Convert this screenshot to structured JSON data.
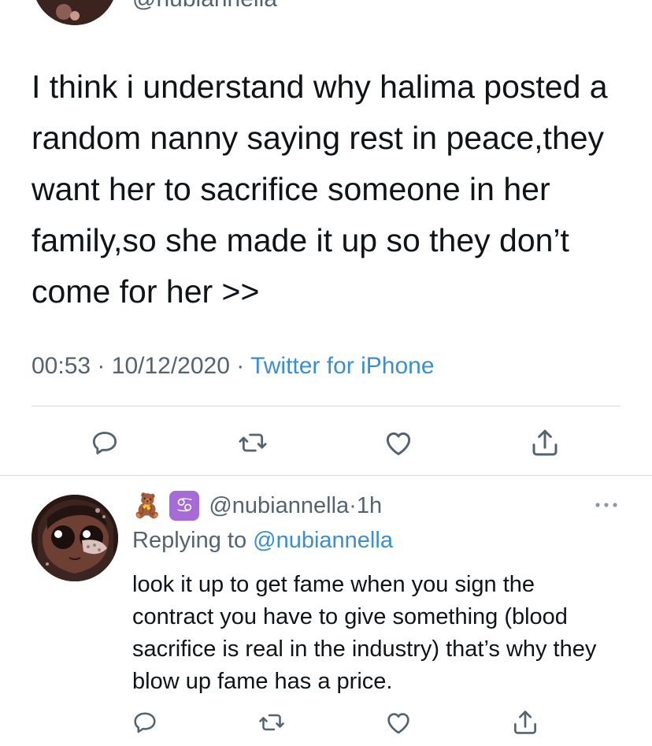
{
  "main_tweet": {
    "handle": "@nubiannella",
    "text": "I think i understand why halima posted a random nanny saying rest in peace,they want her to sacrifice someone in her family,so she made it up so they don’t come for her >>",
    "time": "00:53",
    "date": "10/12/2020",
    "source": "Twitter for iPhone",
    "separator": "·"
  },
  "actions": {
    "reply_icon": "reply-icon",
    "retweet_icon": "retweet-icon",
    "like_icon": "heart-icon",
    "share_icon": "share-icon"
  },
  "reply": {
    "emoji_bear": "🧸",
    "emoji_cancer": "♋",
    "handle": "@nubiannella",
    "separator": "·",
    "age": "1h",
    "replying_prefix": "Replying to",
    "replying_mention": "@nubiannella",
    "text": "look it up to get fame when you sign the contract you have to give something (blood sacrifice is real in the industry) that’s why they blow up fame has a price.",
    "more_icon": "more-icon"
  },
  "colors": {
    "text": "#0f1419",
    "secondary": "#536471",
    "link": "#3b8ed0",
    "divider": "#cfd9de"
  }
}
